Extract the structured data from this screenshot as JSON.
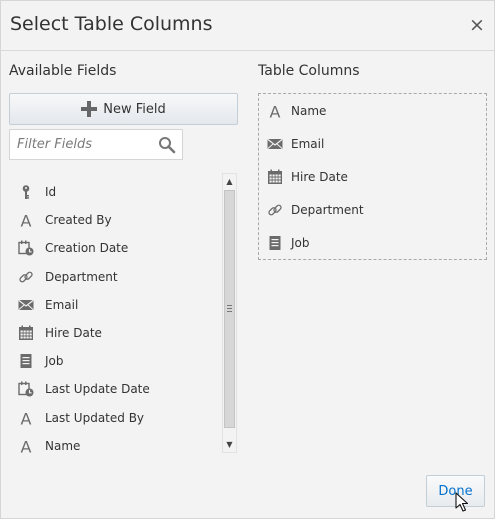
{
  "dialog": {
    "title": "Select Table Columns",
    "close_glyph": "×"
  },
  "available": {
    "heading": "Available Fields",
    "new_field_label": "New Field",
    "filter_placeholder": "Filter Fields",
    "fields": [
      {
        "label": "Id",
        "icon": "key-icon"
      },
      {
        "label": "Created By",
        "icon": "text-type-icon"
      },
      {
        "label": "Creation Date",
        "icon": "calendar-clock-icon"
      },
      {
        "label": "Department",
        "icon": "link-icon"
      },
      {
        "label": "Email",
        "icon": "envelope-icon"
      },
      {
        "label": "Hire Date",
        "icon": "calendar-icon"
      },
      {
        "label": "Job",
        "icon": "list-document-icon"
      },
      {
        "label": "Last Update Date",
        "icon": "calendar-clock-icon"
      },
      {
        "label": "Last Updated By",
        "icon": "text-type-icon"
      },
      {
        "label": "Name",
        "icon": "text-type-icon"
      }
    ]
  },
  "table_columns": {
    "heading": "Table Columns",
    "columns": [
      {
        "label": "Name",
        "icon": "text-type-icon"
      },
      {
        "label": "Email",
        "icon": "envelope-icon"
      },
      {
        "label": "Hire Date",
        "icon": "calendar-icon"
      },
      {
        "label": "Department",
        "icon": "link-icon"
      },
      {
        "label": "Job",
        "icon": "list-document-icon"
      }
    ]
  },
  "footer": {
    "done_label": "Done"
  },
  "colors": {
    "accent": "#0572ce",
    "icon": "#6b6b6b"
  }
}
